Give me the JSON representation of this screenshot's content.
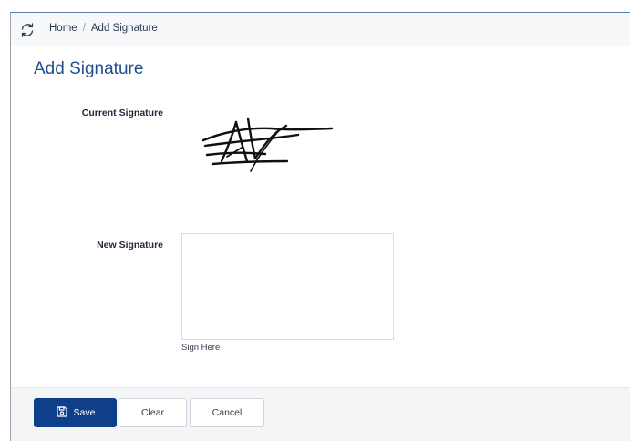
{
  "breadcrumb": {
    "home": "Home",
    "separator": "/",
    "current": "Add Signature"
  },
  "page": {
    "title": "Add Signature"
  },
  "form": {
    "current_signature_label": "Current Signature",
    "new_signature_label": "New Signature",
    "sign_hint": "Sign Here"
  },
  "actions": {
    "save_label": "Save",
    "clear_label": "Clear",
    "cancel_label": "Cancel"
  },
  "icons": {
    "refresh": "refresh-icon",
    "save": "save-icon"
  },
  "colors": {
    "primary": "#0f3f8a",
    "title": "#1f4f8f",
    "footer_bg": "#f4f5f6"
  }
}
